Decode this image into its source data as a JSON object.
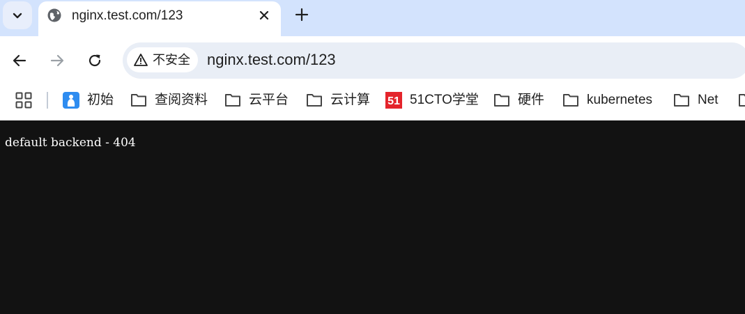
{
  "tabstrip": {
    "tab_title": "nginx.test.com/123"
  },
  "toolbar": {
    "security_label": "不安全",
    "url": "nginx.test.com/123"
  },
  "bookmarks": [
    {
      "label": "初始",
      "icon": "app-favicon-icon"
    },
    {
      "label": "查阅资料",
      "icon": "folder-icon"
    },
    {
      "label": "云平台",
      "icon": "folder-icon"
    },
    {
      "label": "云计算",
      "icon": "folder-icon"
    },
    {
      "label": "51CTO学堂",
      "icon": "51cto-favicon-icon"
    },
    {
      "label": "硬件",
      "icon": "folder-icon"
    },
    {
      "label": "kubernetes",
      "icon": "folder-icon"
    },
    {
      "label": "Net",
      "icon": "folder-icon"
    }
  ],
  "page": {
    "text": "default backend - 404"
  },
  "colors": {
    "tabstrip_bg": "#d3e3fd",
    "omnibox_bg": "#e9eef6",
    "page_bg": "#121212",
    "brand_51cto": "#e4242b",
    "app_icon_blue": "#2e8cf0"
  }
}
